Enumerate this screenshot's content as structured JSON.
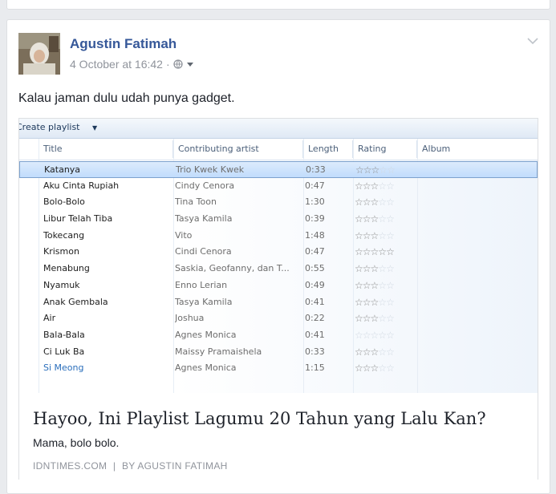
{
  "post": {
    "author": "Agustin Fatimah",
    "timestamp": "4 October at 16:42",
    "separator": "·",
    "text": "Kalau jaman dulu udah punya gadget."
  },
  "icons": {
    "privacy": "globe-icon",
    "privacy_caret": "caret-down-icon",
    "options": "chevron-down-icon"
  },
  "screenshot": {
    "toolbar_label": "Create playlist",
    "toolbar_caret": "▼",
    "columns": [
      "Title",
      "Contributing artist",
      "Length",
      "Rating",
      "Album"
    ],
    "tracks": [
      {
        "title": "Katanya",
        "artist": "Trio Kwek Kwek",
        "length": "0:33",
        "rating": 3
      },
      {
        "title": "Aku Cinta Rupiah",
        "artist": "Cindy Cenora",
        "length": "0:47",
        "rating": 3
      },
      {
        "title": "Bolo-Bolo",
        "artist": "Tina Toon",
        "length": "1:30",
        "rating": 3
      },
      {
        "title": "Libur Telah Tiba",
        "artist": "Tasya Kamila",
        "length": "0:39",
        "rating": 3
      },
      {
        "title": "Tokecang",
        "artist": "Vito",
        "length": "1:48",
        "rating": 3
      },
      {
        "title": "Krismon",
        "artist": "Cindi Cenora",
        "length": "0:47",
        "rating": 5
      },
      {
        "title": "Menabung",
        "artist": "Saskia, Geofanny, dan T...",
        "length": "0:55",
        "rating": 3
      },
      {
        "title": "Nyamuk",
        "artist": "Enno Lerian",
        "length": "0:49",
        "rating": 3
      },
      {
        "title": "Anak Gembala",
        "artist": "Tasya Kamila",
        "length": "0:41",
        "rating": 3
      },
      {
        "title": "Air",
        "artist": "Joshua",
        "length": "0:22",
        "rating": 3
      },
      {
        "title": "Bala-Bala",
        "artist": "Agnes Monica",
        "length": "0:41",
        "rating": 0
      },
      {
        "title": "Ci Luk Ba",
        "artist": "Maissy Pramaishela",
        "length": "0:33",
        "rating": 3
      },
      {
        "title": "Si Meong",
        "artist": "Agnes Monica",
        "length": "1:15",
        "rating": 3
      }
    ],
    "selected_index": 0,
    "link_row_index": 12
  },
  "link": {
    "title": "Hayoo, Ini Playlist Lagumu 20 Tahun yang Lalu Kan?",
    "description": "Mama, bolo bolo.",
    "source": "IDNTIMES.COM",
    "divider": "|",
    "byline": "BY AGUSTIN FATIMAH"
  },
  "colors": {
    "author_link": "#365899",
    "meta_text": "#90949c",
    "selection": "#c1dcfc",
    "link_row": "#2a6ebb"
  }
}
